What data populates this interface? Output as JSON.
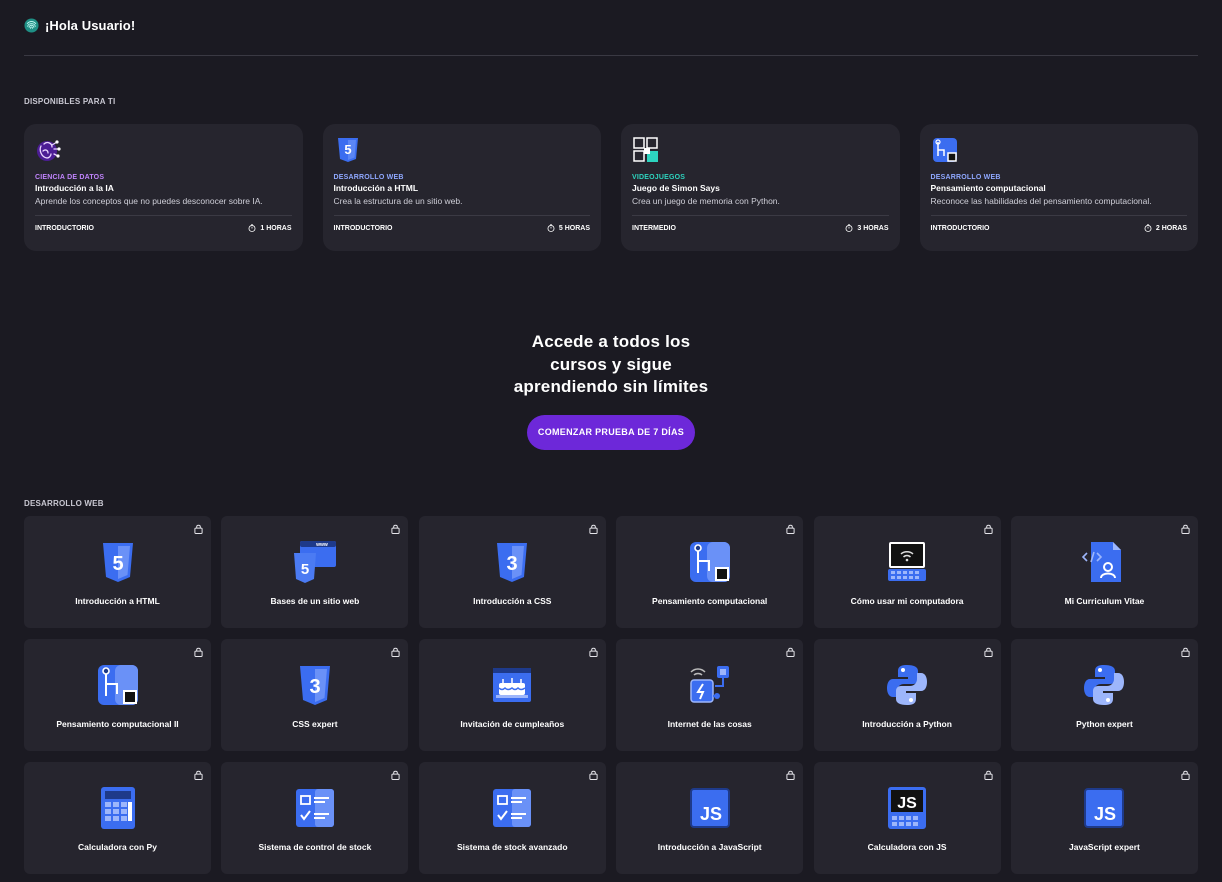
{
  "header": {
    "greeting": "¡Hola Usuario!",
    "logo_icon": "fingerprint-icon"
  },
  "available": {
    "label": "DISPONIBLES PARA TI",
    "cards": [
      {
        "category": "CIENCIA DE DATOS",
        "category_color": "#c084fc",
        "title": "Introducción a la IA",
        "description": "Aprende los conceptos que no puedes desconocer sobre IA.",
        "level": "INTRODUCTORIO",
        "duration": "1 HORAS",
        "icon": "brain-icon"
      },
      {
        "category": "DESARROLLO WEB",
        "category_color": "#8fa8ff",
        "title": "Introducción a HTML",
        "description": "Crea la estructura de un sitio web.",
        "level": "INTRODUCTORIO",
        "duration": "5 HORAS",
        "icon": "html5-icon"
      },
      {
        "category": "VIDEOJUEGOS",
        "category_color": "#2dd4bf",
        "title": "Juego de Simon Says",
        "description": "Crea un juego de memoria con Python.",
        "level": "INTERMEDIO",
        "duration": "3 HORAS",
        "icon": "simon-game-icon"
      },
      {
        "category": "DESARROLLO WEB",
        "category_color": "#8fa8ff",
        "title": "Pensamiento computacional",
        "description": "Reconoce las habilidades del pensamiento computacional.",
        "level": "INTRODUCTORIO",
        "duration": "2 HORAS",
        "icon": "circuit-icon"
      }
    ]
  },
  "promo": {
    "line1": "Accede a todos los",
    "line2": "cursos y sigue",
    "line3": "aprendiendo sin límites",
    "button": "COMENZAR PRUEBA DE 7 DÍAS"
  },
  "web": {
    "label": "DESARROLLO WEB",
    "courses": [
      {
        "name": "Introducción a HTML",
        "icon": "html5-icon"
      },
      {
        "name": "Bases de un sitio web",
        "icon": "website-icon"
      },
      {
        "name": "Introducción a CSS",
        "icon": "css3-icon"
      },
      {
        "name": "Pensamiento computacional",
        "icon": "circuit-icon"
      },
      {
        "name": "Cómo usar mi computadora",
        "icon": "laptop-icon"
      },
      {
        "name": "Mi Curriculum Vitae",
        "icon": "cv-document-icon"
      },
      {
        "name": "Pensamiento computacional II",
        "icon": "circuit-icon"
      },
      {
        "name": "CSS expert",
        "icon": "css3-icon"
      },
      {
        "name": "Invitación de cumpleaños",
        "icon": "birthday-cake-icon"
      },
      {
        "name": "Internet de las cosas",
        "icon": "iot-icon"
      },
      {
        "name": "Introducción a Python",
        "icon": "python-icon"
      },
      {
        "name": "Python expert",
        "icon": "python-icon"
      },
      {
        "name": "Calculadora con Py",
        "icon": "calculator-icon"
      },
      {
        "name": "Sistema de control de stock",
        "icon": "checklist-icon"
      },
      {
        "name": "Sistema de stock avanzado",
        "icon": "checklist-icon"
      },
      {
        "name": "Introducción a JavaScript",
        "icon": "javascript-icon"
      },
      {
        "name": "Calculadora con JS",
        "icon": "javascript-calculator-icon"
      },
      {
        "name": "JavaScript expert",
        "icon": "javascript-icon"
      }
    ]
  },
  "colors": {
    "background": "#1b1a22",
    "card": "#26252e",
    "accent": "#6d28d9",
    "icon_blue": "#3b6df0"
  }
}
